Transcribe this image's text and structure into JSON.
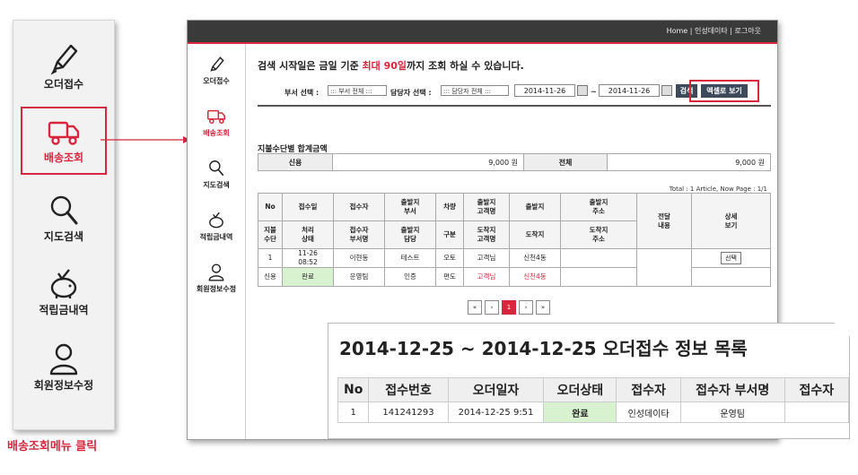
{
  "left_menu": {
    "items": [
      {
        "label": "오더접수",
        "icon": "pencil-icon"
      },
      {
        "label": "배송조회",
        "icon": "truck-icon"
      },
      {
        "label": "지도검색",
        "icon": "magnifier-icon"
      },
      {
        "label": "적립금내역",
        "icon": "piggy-bank-icon"
      },
      {
        "label": "회원정보수정",
        "icon": "user-icon"
      }
    ],
    "caption": "배송조회메뉴 클릭"
  },
  "topbar": {
    "links": "Home | 인성데이타 | 로그아웃"
  },
  "sidebar": {
    "items": [
      {
        "label": "오더접수"
      },
      {
        "label": "배송조회"
      },
      {
        "label": "지도검색"
      },
      {
        "label": "적립금내역"
      },
      {
        "label": "회원정보수정"
      }
    ]
  },
  "notice": {
    "pre": "검색 시작일은 금일 기준 ",
    "red": "최대 90일",
    "post": "까지 조회 하실 수 있습니다."
  },
  "filters": {
    "dept_label": "부서 선택 :",
    "dept_value": "::: 부서 전체 :::",
    "person_label": "담당자 선택 :",
    "person_value": "::: 담당자 전체 :::",
    "date_from": "2014-11-26",
    "tilde": "~",
    "date_to": "2014-11-26",
    "search_btn": "검색",
    "excel_btn": "엑셀로 보기"
  },
  "payment": {
    "title": "지불수단별 합계금액",
    "credit_label": "신용",
    "credit_value": "9,000 원",
    "total_label": "전체",
    "total_value": "9,000 원"
  },
  "total_info": "Total : 1 Article, Now Page : 1/1",
  "grid": {
    "header1": [
      "No",
      "접수일",
      "접수자",
      "출발지\n부서",
      "차량",
      "출발지\n고객명",
      "출발지",
      "출발지\n주소",
      "전달\n내용",
      "상세\n보기"
    ],
    "header2": [
      "지불\n수단",
      "처리\n상태",
      "접수자\n부서명",
      "출발지\n담당",
      "구분",
      "도착지\n고객명",
      "도착지",
      "도착지\n주소"
    ],
    "row1": [
      "1",
      "11-26\n08:52",
      "이현동",
      "테스트",
      "오토",
      "고객님",
      "신천4동",
      ""
    ],
    "row2": [
      "신용",
      "완료",
      "운영팀",
      "인증",
      "편도",
      "고객님",
      "신천4동",
      ""
    ],
    "detail_btn": "선택"
  },
  "pager": [
    "«",
    "‹",
    "1",
    "›",
    "»"
  ],
  "zoom": {
    "title": "2014-12-25 ~ 2014-12-25 오더접수 정보 목록",
    "headers": [
      "No",
      "접수번호",
      "오더일자",
      "오더상태",
      "접수자",
      "접수자 부서명",
      "접수자"
    ],
    "row": [
      "1",
      "141241293",
      "2014-12-25 9:51",
      "완료",
      "인성데이타",
      "운영팀",
      ""
    ]
  }
}
